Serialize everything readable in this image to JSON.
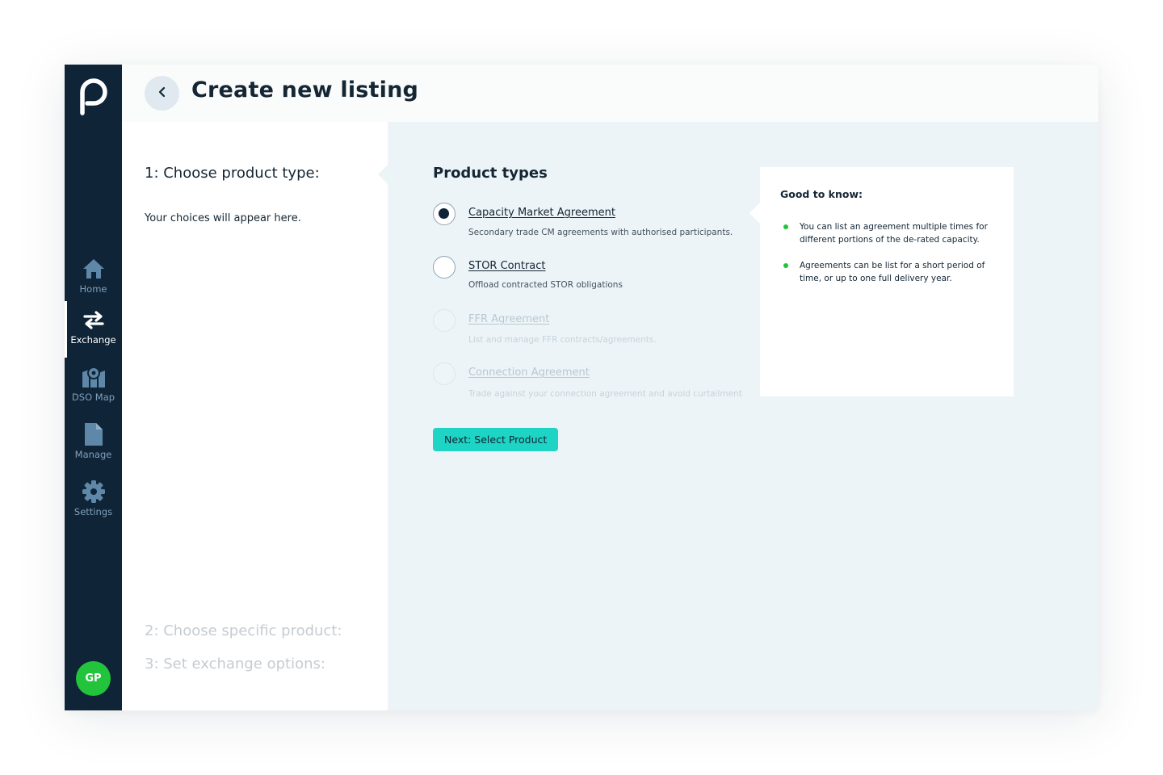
{
  "app": {
    "logo": "p-logo"
  },
  "header": {
    "title": "Create new listing",
    "back_icon": "chevron-left-icon"
  },
  "sidebar": {
    "items": [
      {
        "label": "Home",
        "icon": "home-icon",
        "active": false
      },
      {
        "label": "Exchange",
        "icon": "exchange-arrows-icon",
        "active": true
      },
      {
        "label": "DSO Map",
        "icon": "map-pin-icon",
        "active": false
      },
      {
        "label": "Manage",
        "icon": "document-icon",
        "active": false
      },
      {
        "label": "Settings",
        "icon": "gear-icon",
        "active": false
      }
    ],
    "avatar_initials": "GP"
  },
  "steps": {
    "step1": "1: Choose product type:",
    "hint": "Your choices will appear here.",
    "step2": "2: Choose specific product:",
    "step3": "3: Set exchange options:"
  },
  "product_types": {
    "title": "Product types",
    "options": [
      {
        "name": "Capacity Market Agreement",
        "desc": "Secondary trade CM agreements with authorised participants.",
        "selected": true,
        "disabled": false
      },
      {
        "name": "STOR Contract",
        "desc": "Offload contracted STOR obligations",
        "selected": false,
        "disabled": false
      },
      {
        "name": "FFR Agreement",
        "desc": "List and manage FFR contracts/agreements.",
        "selected": false,
        "disabled": true
      },
      {
        "name": "Connection Agreement",
        "desc": "Trade against your connection agreement and avoid curtailment",
        "selected": false,
        "disabled": true
      }
    ],
    "next_label": "Next: Select Product"
  },
  "info": {
    "title": "Good to know:",
    "items": [
      "You can list an agreement multiple times for different portions of the de-rated capacity.",
      "Agreements can be list for a short period of time, or up to one full delivery year."
    ]
  },
  "colors": {
    "sidebar": "#0f2437",
    "accent": "#1ed4c4",
    "avatar": "#21c43a",
    "panel_bg": "#ecf4f7"
  }
}
